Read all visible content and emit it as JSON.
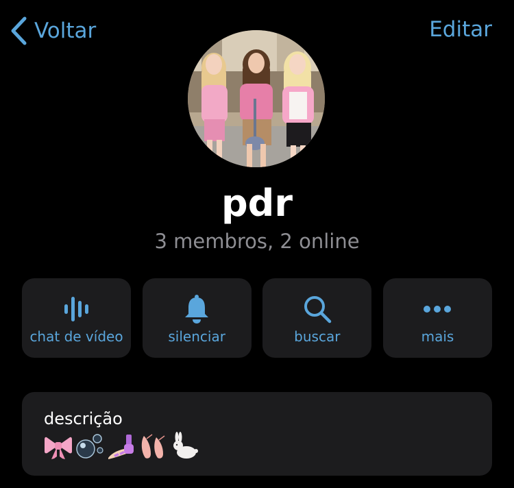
{
  "nav": {
    "back_label": "Voltar",
    "edit_label": "Editar"
  },
  "group": {
    "name": "pdr",
    "status": "3 membros, 2 online"
  },
  "actions": [
    {
      "label": "chat de vídeo",
      "icon": "waveform-icon"
    },
    {
      "label": "silenciar",
      "icon": "bell-icon"
    },
    {
      "label": "buscar",
      "icon": "search-icon"
    },
    {
      "label": "mais",
      "icon": "more-icon"
    }
  ],
  "description": {
    "title": "descrição",
    "emojis": [
      "ribbon-emoji",
      "bubbles-emoji",
      "nail-polish-emoji",
      "ballet-shoes-emoji",
      "rabbit-emoji"
    ]
  },
  "colors": {
    "accent": "#5aa6dc",
    "card_background": "#1c1c1e",
    "secondary_text": "#8e8e93",
    "background": "#000000"
  }
}
